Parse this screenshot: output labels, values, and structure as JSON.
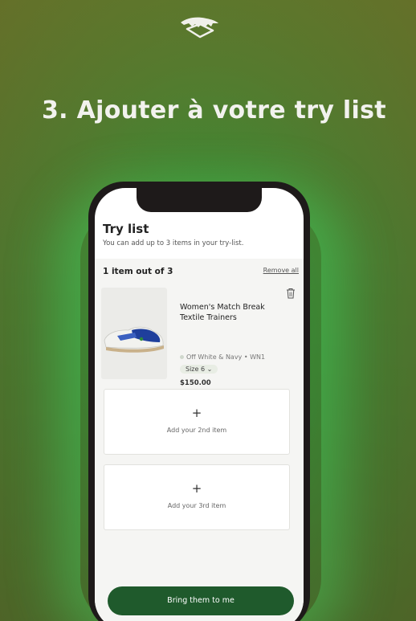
{
  "headline": "3. Ajouter à votre try list",
  "brand": {
    "logo_icon": "crocodile-logo-icon"
  },
  "try_list": {
    "title": "Try list",
    "subtitle": "You can add up to 3 items in your try-list.",
    "count_label": "1 item out of 3",
    "remove_all_label": "Remove all",
    "item": {
      "name": "Women's Match Break Textile Trainers",
      "color": "Off White & Navy • WN1",
      "size": "Size 6 ⌄",
      "price": "$150.00",
      "delete_icon": "trash-icon",
      "image_icon": "sneaker-image"
    },
    "slots": [
      {
        "plus": "+",
        "label": "Add your 2nd item"
      },
      {
        "plus": "+",
        "label": "Add your 3rd item"
      }
    ],
    "cta_label": "Bring them to me"
  },
  "colors": {
    "background": "#3f8a36",
    "cta": "#1f5a2c",
    "phone_frame": "#1e1a1a"
  }
}
